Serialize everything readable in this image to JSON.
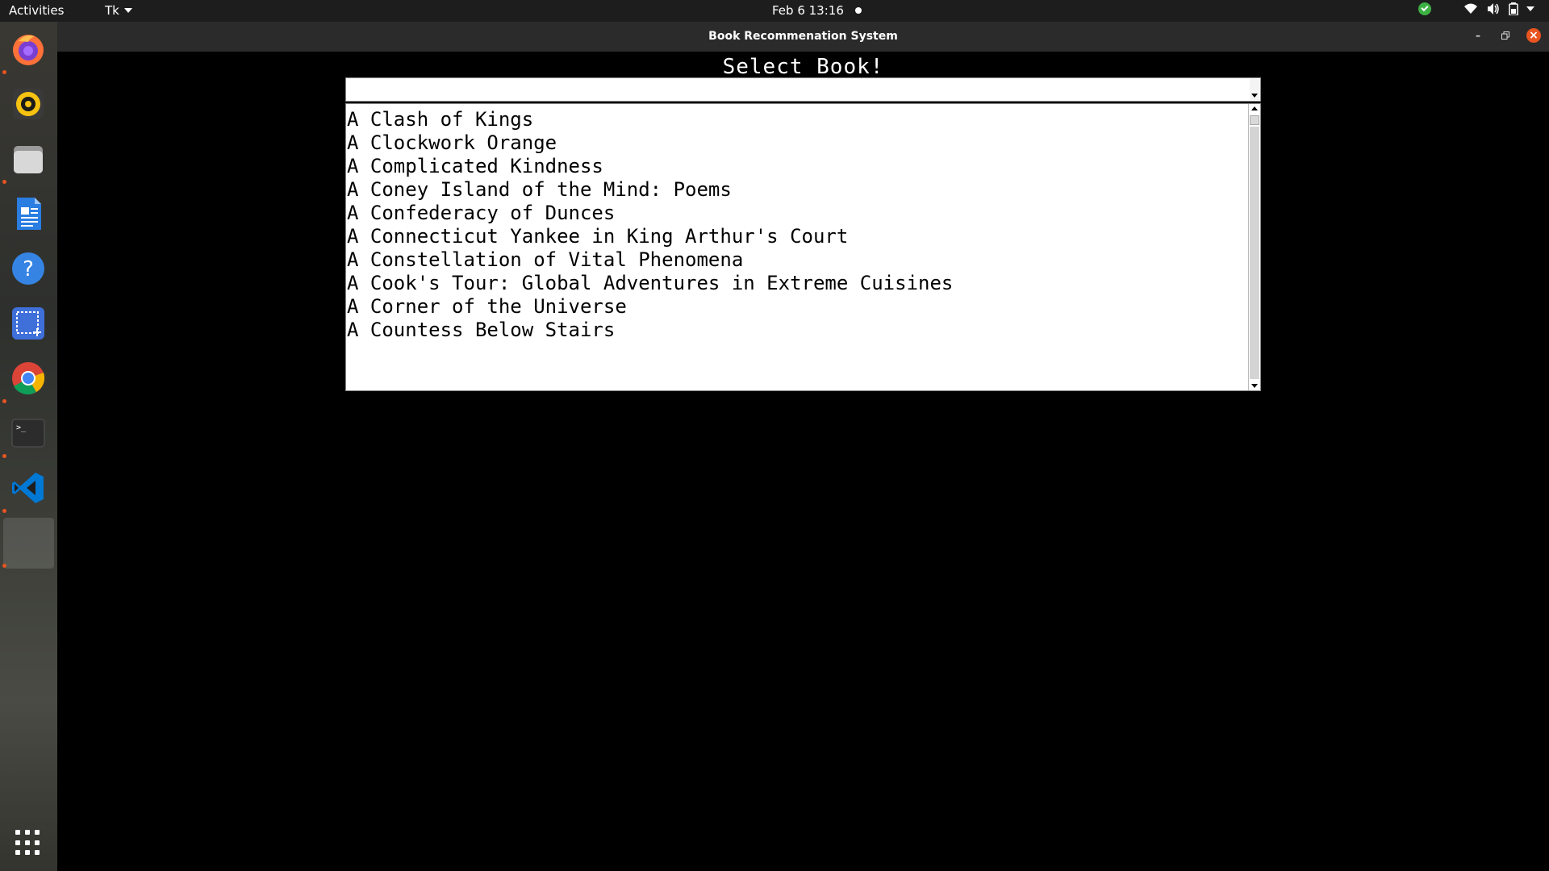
{
  "topbar": {
    "activities": "Activities",
    "app_menu": "Tk",
    "clock": "Feb 6  13:16"
  },
  "dock": {
    "items": [
      {
        "name": "firefox",
        "running": true
      },
      {
        "name": "rhythmbox",
        "running": false
      },
      {
        "name": "files",
        "running": true
      },
      {
        "name": "libreoffice-writer",
        "running": false
      },
      {
        "name": "help",
        "running": false
      },
      {
        "name": "screenshot",
        "running": false
      },
      {
        "name": "chrome",
        "running": true
      },
      {
        "name": "terminal",
        "running": true
      },
      {
        "name": "vscode",
        "running": true
      },
      {
        "name": "tk-app",
        "running": true
      }
    ]
  },
  "window": {
    "title": "Book Recommenation System"
  },
  "app": {
    "heading": "Select Book!",
    "search_value": "",
    "books": [
      "A Clash of Kings",
      "A Clockwork Orange",
      "A Complicated Kindness",
      "A Coney Island of the Mind: Poems",
      "A Confederacy of Dunces",
      "A Connecticut Yankee in King Arthur's Court",
      "A Constellation of Vital Phenomena",
      "A Cook's Tour: Global Adventures in Extreme Cuisines",
      "A Corner of the Universe",
      "A Countess Below Stairs"
    ]
  },
  "colors": {
    "accent": "#e95420",
    "topbar_bg": "#1d1d1d",
    "titlebar_bg": "#2b2b2b",
    "window_bg": "#000000",
    "list_bg": "#ffffff"
  }
}
